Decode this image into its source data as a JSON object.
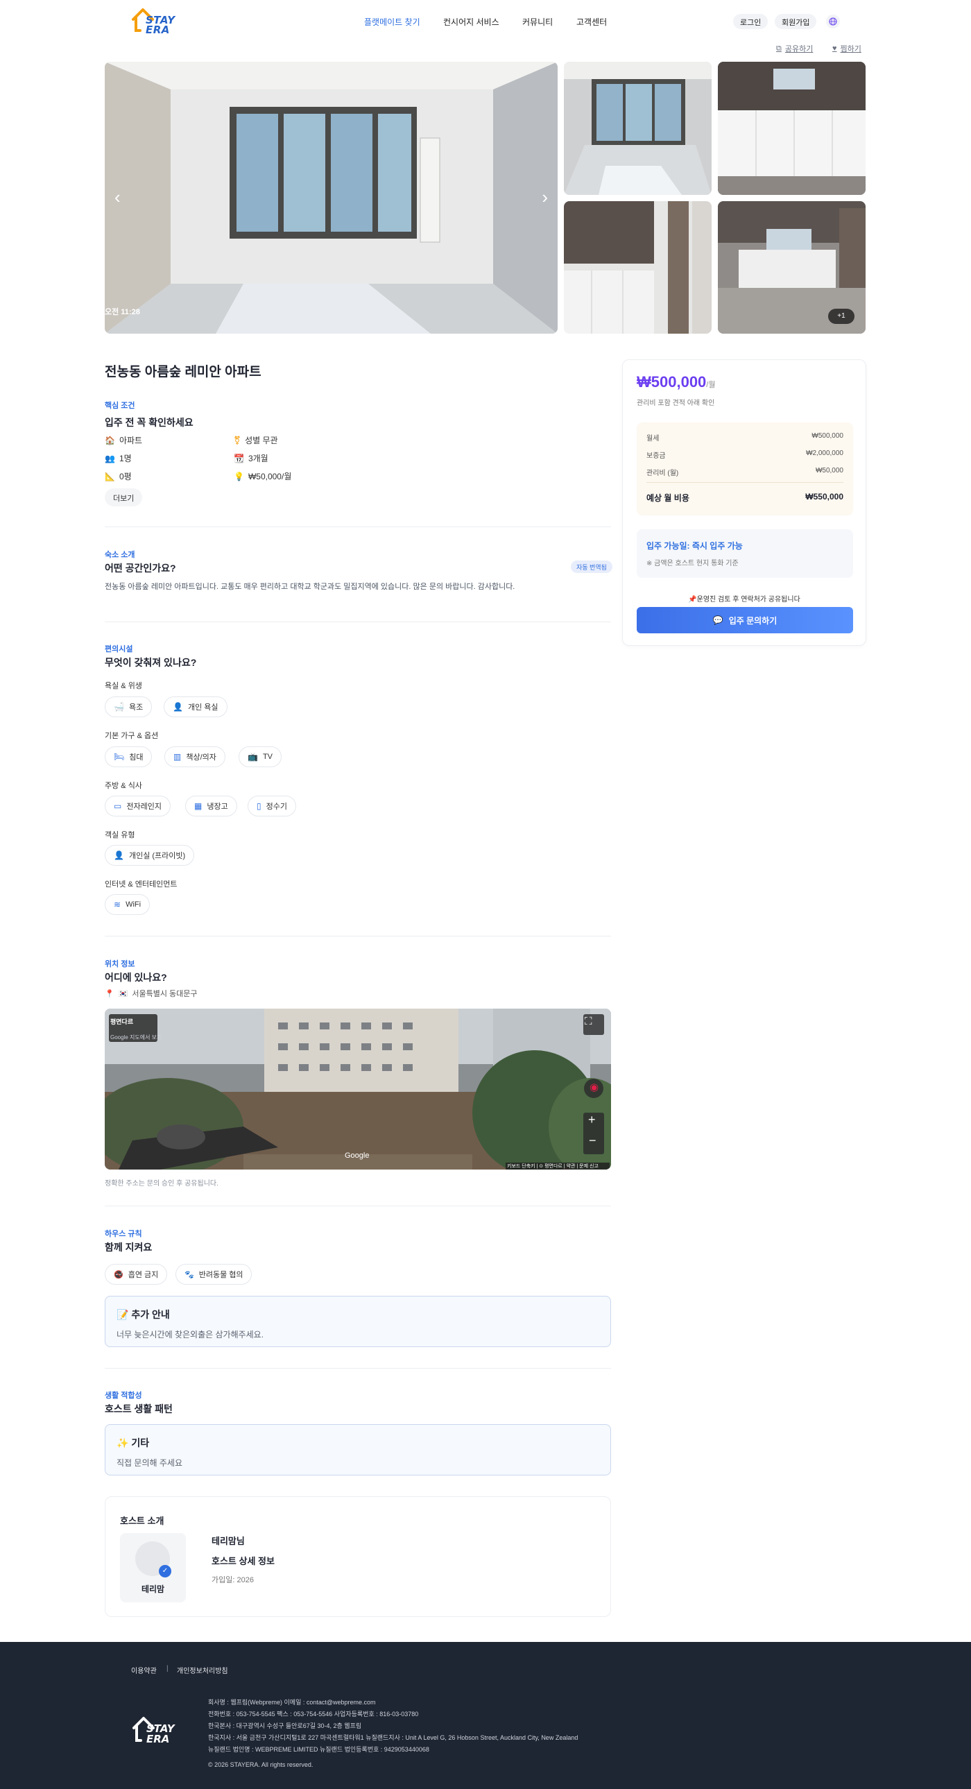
{
  "header": {
    "logo_text_1": "STAY",
    "logo_text_2": "ERA",
    "nav": [
      "플랫메이트 찾기",
      "컨시어지 서비스",
      "커뮤니티",
      "고객센터"
    ],
    "login": "로그인",
    "signup": "회원가입"
  },
  "actions": {
    "share": "공유하기",
    "wishlist": "찜하기"
  },
  "gallery": {
    "timestamp": "오전 11:28",
    "more_count": "+1"
  },
  "listing": {
    "title": "전농동 아름숲 레미안 아파트",
    "core": {
      "kicker": "핵심 조건",
      "title": "입주 전 꼭 확인하세요",
      "attributes": [
        {
          "icon": "house-icon",
          "glyph": "🏠",
          "label": "아파트"
        },
        {
          "icon": "gender-icon",
          "glyph": "⚧",
          "label": "성별 무관"
        },
        {
          "icon": "people-icon",
          "glyph": "👥",
          "label": "1명"
        },
        {
          "icon": "calendar-icon",
          "glyph": "📆",
          "label": "3개월"
        },
        {
          "icon": "ruler-icon",
          "glyph": "📐",
          "label": "0평"
        },
        {
          "icon": "bulb-icon",
          "glyph": "💡",
          "label": "₩50,000/월"
        }
      ],
      "more": "더보기"
    },
    "intro": {
      "kicker": "숙소 소개",
      "title": "어떤 공간인가요?",
      "badge": "자동 번역됨",
      "text": "전농동 아름숲 레미안 아파트입니다. 교통도 매우 편리하고 대학교 학군과도 밀집지역에 있습니다. 많은 문의 바랍니다. 감사합니다."
    },
    "amenities": {
      "kicker": "편의시설",
      "title": "무엇이 갖춰져 있나요?",
      "groups": [
        {
          "label": "욕실 & 위생",
          "items": [
            {
              "icon": "bathtub-icon",
              "glyph": "🛁",
              "label": "욕조"
            },
            {
              "icon": "person-icon",
              "glyph": "👤",
              "label": "개인 욕실"
            }
          ]
        },
        {
          "label": "기본 가구 & 옵션",
          "items": [
            {
              "icon": "bed-icon",
              "glyph": "🛏",
              "label": "침대"
            },
            {
              "icon": "desk-icon",
              "glyph": "▥",
              "label": "책상/의자"
            },
            {
              "icon": "tv-icon",
              "glyph": "📺",
              "label": "TV"
            }
          ]
        },
        {
          "label": "주방 & 식사",
          "items": [
            {
              "icon": "microwave-icon",
              "glyph": "▭",
              "label": "전자레인지"
            },
            {
              "icon": "fridge-icon",
              "glyph": "▦",
              "label": "냉장고"
            },
            {
              "icon": "water-purifier-icon",
              "glyph": "▯",
              "label": "정수기"
            }
          ]
        },
        {
          "label": "객실 유형",
          "items": [
            {
              "icon": "person-icon",
              "glyph": "👤",
              "label": "개인실 (프라이빗)"
            }
          ]
        },
        {
          "label": "인터넷 & 엔터테인먼트",
          "items": [
            {
              "icon": "wifi-icon",
              "glyph": "≋",
              "label": "WiFi"
            }
          ]
        }
      ]
    },
    "location": {
      "kicker": "위치 정보",
      "title": "어디에 있나요?",
      "address": "서울특별시 동대문구",
      "map_label": "평면다르",
      "map_sublabel": "Google 지도에서 보기",
      "map_brand": "Google",
      "map_footer": "키보드 단축키 | ⊙ 평면다르 | 약관 | 문제 신고",
      "caption": "정확한 주소는 문의 승인 후 공유됩니다."
    },
    "rules": {
      "kicker": "하우스 규칙",
      "title": "함께 지켜요",
      "items": [
        {
          "glyph": "🚭",
          "label": "흡연 금지"
        },
        {
          "glyph": "🐾",
          "label": "반려동물 협의"
        }
      ],
      "note_title": "📝 추가 안내",
      "note_text": "너무 늦은시간에 찾은외출은 삼가해주세요."
    },
    "lifestyle": {
      "kicker": "생활 적합성",
      "title": "호스트 생활 패턴",
      "note_title": "✨ 기타",
      "note_text": "직접 문의해 주세요"
    },
    "host": {
      "section_title": "호스트 소개",
      "name": "테리맘",
      "display_name": "테리맘님",
      "detail_title": "호스트 상세 정보",
      "joined": "가입일: 2026"
    }
  },
  "booking": {
    "price": "₩500,000",
    "price_unit": "/월",
    "price_note": "관리비 포함 견적 아래 확인",
    "fees": [
      {
        "label": "월세",
        "value": "₩500,000"
      },
      {
        "label": "보증금",
        "value": "₩2,000,000"
      },
      {
        "label": "관리비 (월)",
        "value": "₩50,000"
      }
    ],
    "total_label": "예상 월 비용",
    "total_value": "₩550,000",
    "availability": "입주 가능일: 즉시 입주 가능",
    "availability_note": "※ 금액은 호스트 현지 통화 기준",
    "notice": "📌운영진 검토 후 연락처가 공유됩니다",
    "cta": "입주 문의하기"
  },
  "footer": {
    "links": [
      "이용약관",
      "|",
      "개인정보처리방침"
    ],
    "lines": [
      "회사명 : 웹프림(Webpreme)      이메일 : contact@webpreme.com",
      "전화번호 : 053-754-5545      팩스 : 053-754-5546      사업자등록번호 : 816-03-03780",
      "한국본사 : 대구광역시 수성구 들안로67길 30-4, 2층 웹프림",
      "한국지사 : 서울 금천구 가산디지털1로 227 마곡센트럴타워1      뉴질랜드지사 : Unit A Level G, 26 Hobson Street, Auckland City, New Zealand",
      "뉴질랜드 법인명 : WEBPREME LIMITED      뉴질랜드 법인등록번호 : 9429053440068",
      "© 2026 STAYERA. All rights reserved."
    ]
  },
  "colors": {
    "accent": "#2f6fe0",
    "price": "#6c3ff0",
    "footer_bg": "#1f2633"
  }
}
